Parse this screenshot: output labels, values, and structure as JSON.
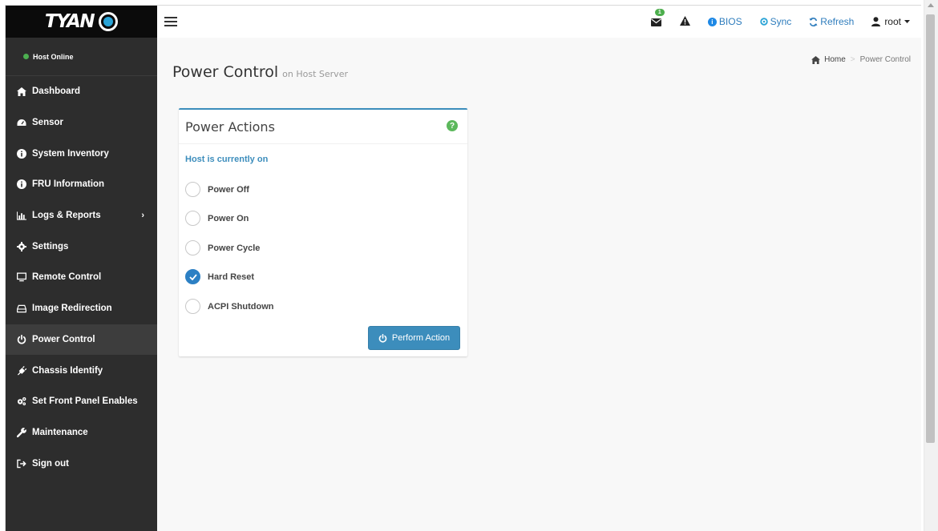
{
  "brand": {
    "logo_text": "TYAN"
  },
  "host_status": {
    "label": "Host Online",
    "color": "#4caf50"
  },
  "sidebar": {
    "items": [
      {
        "label": "Dashboard",
        "icon": "home-icon"
      },
      {
        "label": "Sensor",
        "icon": "gauge-icon"
      },
      {
        "label": "System Inventory",
        "icon": "info-icon"
      },
      {
        "label": "FRU Information",
        "icon": "info-icon"
      },
      {
        "label": "Logs & Reports",
        "icon": "bar-chart-icon",
        "has_submenu": true
      },
      {
        "label": "Settings",
        "icon": "gear-icon"
      },
      {
        "label": "Remote Control",
        "icon": "monitor-icon"
      },
      {
        "label": "Image Redirection",
        "icon": "hdd-icon"
      },
      {
        "label": "Power Control",
        "icon": "power-icon",
        "active": true
      },
      {
        "label": "Chassis Identify",
        "icon": "plug-icon"
      },
      {
        "label": "Set Front Panel Enables",
        "icon": "gears-icon"
      },
      {
        "label": "Maintenance",
        "icon": "wrench-icon"
      },
      {
        "label": "Sign out",
        "icon": "sign-out-icon"
      }
    ]
  },
  "topbar": {
    "notification_count": "1",
    "bios_label": "BIOS",
    "sync_label": "Sync",
    "refresh_label": "Refresh",
    "user_label": "root"
  },
  "page": {
    "title": "Power Control",
    "subtitle": "on Host Server"
  },
  "breadcrumb": {
    "home": "Home",
    "current": "Power Control"
  },
  "panel": {
    "title": "Power Actions",
    "host_state": "Host is currently on",
    "options": [
      {
        "label": "Power Off",
        "checked": false
      },
      {
        "label": "Power On",
        "checked": false
      },
      {
        "label": "Power Cycle",
        "checked": false
      },
      {
        "label": "Hard Reset",
        "checked": true
      },
      {
        "label": "ACPI Shutdown",
        "checked": false
      }
    ],
    "action_label": "Perform Action"
  },
  "colors": {
    "accent": "#3c8dbc",
    "sidebar_bg": "#2d2d2d",
    "success": "#5cb85c"
  }
}
